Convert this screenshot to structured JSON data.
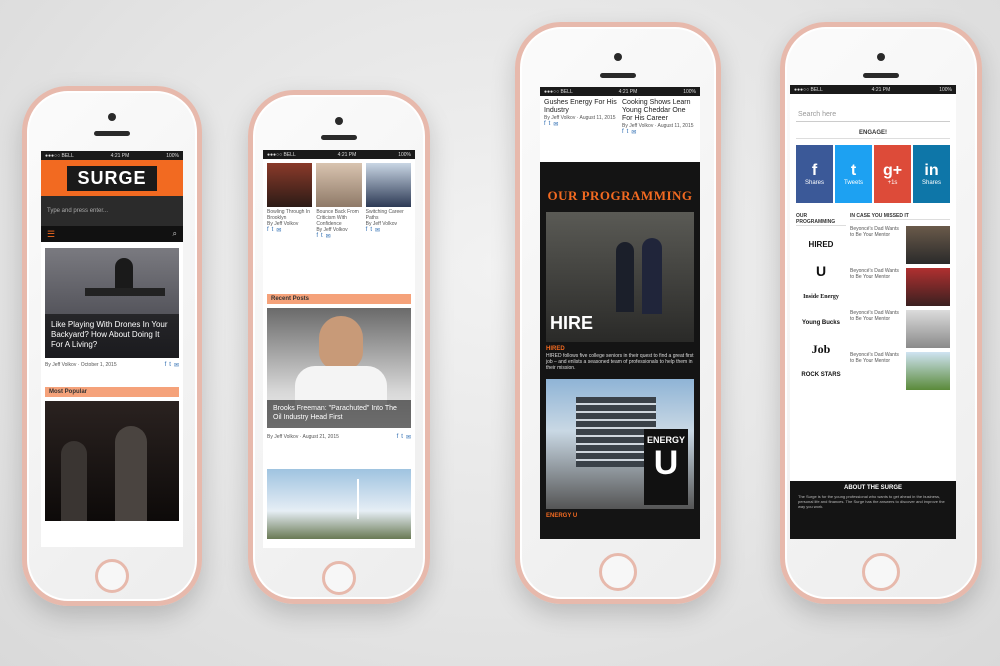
{
  "status": {
    "carrier": "●●●○○ BELL",
    "time": "4:21 PM",
    "battery": "100%"
  },
  "phone1": {
    "logo": "SURGE",
    "search_placeholder": "Type and press enter...",
    "menu_icon": "hamburger-icon",
    "search_icon": "search-icon",
    "hero_headline": "Like Playing With Drones In Your Backyard? How About Doing It For A Living?",
    "hero_meta": "By Jeff Volkov · October 1, 2015",
    "section_title": "Most Popular"
  },
  "phone2": {
    "thumbs": [
      {
        "caption": "Bowling Through In Brooklyn",
        "meta": "By Jeff Volkov"
      },
      {
        "caption": "Bounce Back From Criticism With Confidence",
        "meta": "By Jeff Volkov"
      },
      {
        "caption": "Switching Career Paths",
        "meta": "By Jeff Volkov"
      }
    ],
    "section_title": "Recent Posts",
    "feature_headline": "Brooks Freeman: \"Parachuted\" Into The Oil Industry Head First",
    "feature_meta": "By Jeff Volkov · August 21, 2015"
  },
  "phone3": {
    "top_left": "Gushes Energy For His Industry",
    "top_left_meta": "By Jeff Volkov · August 11, 2015",
    "top_right": "Cooking Shows Learn Young Cheddar One For His Career",
    "top_right_meta": "By Jeff Volkov · August 11, 2015",
    "heading": "OUR PROGRAMMING",
    "hire_label": "HIRE",
    "hire_title": "HIRED",
    "hire_desc": "HIRED follows five college seniors in their quest to find a great first job – and enlists a seasoned team of professionals to help them in their mission.",
    "energy_label": "ENERGY",
    "energy_u": "U",
    "energy_title": "ENERGY U"
  },
  "phone4": {
    "search_placeholder": "Search here",
    "engage_title": "ENGAGE!",
    "shares": [
      {
        "icon": "f",
        "label": "Shares",
        "color": "#3b5998"
      },
      {
        "icon": "t",
        "label": "Tweets",
        "color": "#1da1f2"
      },
      {
        "icon": "g+",
        "label": "+1s",
        "color": "#dd4b39"
      },
      {
        "icon": "in",
        "label": "Shares",
        "color": "#0e76a8"
      }
    ],
    "programming_title": "OUR PROGRAMMING",
    "missed_title": "IN CASE YOU MISSED IT",
    "programs": [
      "HIRED",
      "U",
      "Inside Energy",
      "Young Bucks",
      "Job",
      "ROCK STARS"
    ],
    "missed": [
      "Beyoncé's Dad Wants to Be Your Mentor",
      "Beyoncé's Dad Wants to Be Your Mentor",
      "Beyoncé's Dad Wants to Be Your Mentor",
      "Beyoncé's Dad Wants to Be Your Mentor"
    ],
    "about_title": "ABOUT THE SURGE",
    "about_text": "The Surge is for the young professional who wants to get ahead in the business, personal life and finances. The Surge has the answers to discover and improve the way you work."
  }
}
